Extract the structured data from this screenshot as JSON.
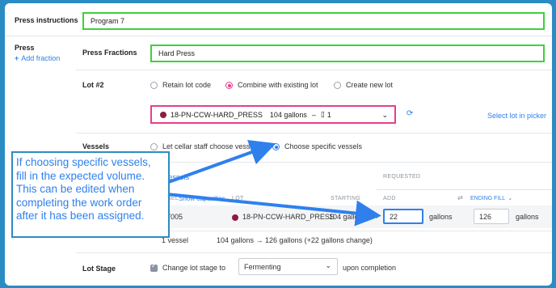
{
  "press_instructions": {
    "label": "Press instructions",
    "value": "Program 7"
  },
  "press": {
    "label": "Press",
    "add_fraction": "Add fraction"
  },
  "press_fractions": {
    "label": "Press Fractions",
    "value": "Hard Press"
  },
  "lot": {
    "label": "Lot #2",
    "options": [
      "Retain lot code",
      "Combine with existing lot",
      "Create new lot"
    ],
    "selected_index": 1,
    "selection": {
      "code": "18-PN-CCW-HARD_PRESS",
      "volume": "104 gallons",
      "separator": "–",
      "vessel_count": "1"
    },
    "select_link": "Select lot in picker"
  },
  "vessels": {
    "label": "Vessels",
    "options": [
      "Let cellar staff choose vessels",
      "Choose specific vessels"
    ],
    "selected_index": 1,
    "edit_link": "Edit vessels",
    "requested_header": "REQUESTED",
    "columns": {
      "vessel": "VESSEL",
      "show_capacities": "Show capacities",
      "lot": "LOT",
      "starting": "STARTING",
      "add": "ADD",
      "ending_fill": "ENDING FILL"
    },
    "row": {
      "vessel": "PT005",
      "lot": "18-PN-CCW-HARD_PRESS",
      "starting": "104 gallons",
      "plus": "+",
      "add": "22",
      "add_unit": "gallons",
      "ending": "126",
      "ending_unit": "gallons"
    },
    "summary": {
      "count": "1 vessel",
      "change": "104 gallons → 126 gallons (+22 gallons change)"
    }
  },
  "lot_stage": {
    "label": "Lot Stage",
    "checkbox_label": "Change lot stage to",
    "stage": "Fermenting",
    "suffix": "upon completion"
  },
  "callout": {
    "lines": [
      "If choosing specific vessels,",
      "fill in the expected volume.",
      "This can be edited when",
      "completing the work order",
      "after it has been assigned."
    ]
  },
  "colors": {
    "highlight_green": "#3bd23b",
    "highlight_pink": "#e83e8c",
    "accent_blue": "#2f80ed",
    "lot_dot": "#8b1e3f"
  }
}
